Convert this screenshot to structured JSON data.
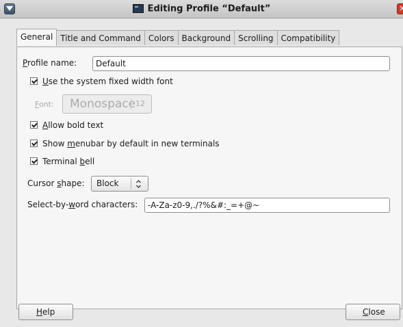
{
  "window": {
    "title": "Editing Profile “Default”"
  },
  "tabs": [
    {
      "label": "General",
      "active": true
    },
    {
      "label": "Title and Command",
      "active": false
    },
    {
      "label": "Colors",
      "active": false
    },
    {
      "label": "Background",
      "active": false
    },
    {
      "label": "Scrolling",
      "active": false
    },
    {
      "label": "Compatibility",
      "active": false
    }
  ],
  "general": {
    "profile_name": {
      "mnemonic": "P",
      "label_rest": "rofile name:",
      "value": "Default"
    },
    "use_system_font": {
      "checked": true,
      "mnemonic": "U",
      "label_rest": "se the system fixed width font"
    },
    "font": {
      "mnemonic": "F",
      "label_rest": "ont:",
      "name": "Monospace",
      "size": "12"
    },
    "allow_bold": {
      "checked": true,
      "mnemonic": "A",
      "label_rest": "llow bold text"
    },
    "show_menubar": {
      "checked": true,
      "pre": "Show ",
      "mnemonic": "m",
      "label_rest": "enubar by default in new terminals"
    },
    "terminal_bell": {
      "checked": true,
      "pre": "Terminal ",
      "mnemonic": "b",
      "label_rest": "ell"
    },
    "cursor_shape": {
      "pre": "Cursor ",
      "mnemonic": "s",
      "label_rest": "hape:",
      "value": "Block"
    },
    "select_by_word": {
      "pre": "Select-by-",
      "mnemonic": "w",
      "label_rest": "ord characters:",
      "value": "-A-Za-z0-9,./?%&#:_=+@~"
    }
  },
  "buttons": {
    "help": {
      "mnemonic": "H",
      "label_rest": "elp"
    },
    "close": {
      "mnemonic": "C",
      "label_rest": "lose"
    }
  },
  "colors": {
    "window_bg": "#e8e8e8",
    "panel_bg": "#f6f6f6",
    "close_button": "#d43b2a"
  }
}
